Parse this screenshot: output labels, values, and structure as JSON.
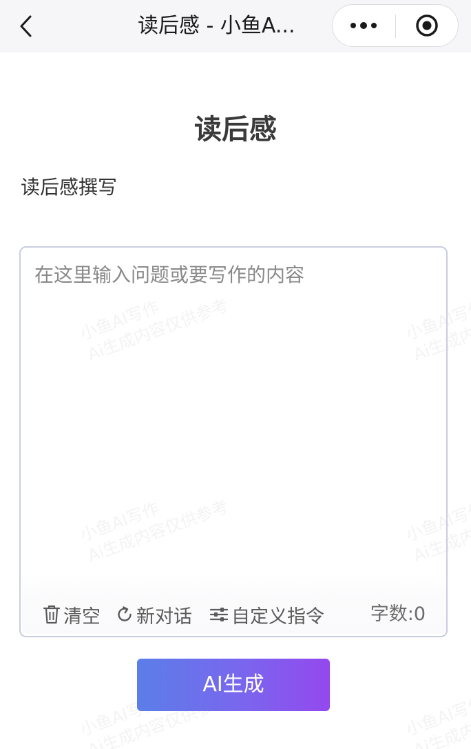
{
  "navbar": {
    "title": "读后感 - 小鱼A...",
    "back_icon": "chevron-left-icon",
    "more_icon": "more-dots-icon",
    "close_icon": "target-circle-icon"
  },
  "page": {
    "title": "读后感",
    "subtitle": "读后感撰写"
  },
  "editor": {
    "value": "",
    "placeholder": "在这里输入问题或要写作的内容"
  },
  "toolbar": {
    "clear_label": "清空",
    "clear_icon": "trash-icon",
    "new_chat_label": "新对话",
    "new_chat_icon": "refresh-icon",
    "custom_label": "自定义指令",
    "custom_icon": "sliders-icon",
    "word_count": "字数:0"
  },
  "generate_button": {
    "label": "AI生成"
  },
  "watermark": {
    "line1": "小鱼AI写作",
    "line2": "Ai生成内容仅供参考"
  },
  "colors": {
    "button_gradient_start": "#5b7ee8",
    "button_gradient_end": "#9448ee",
    "editor_border": "#c9cde0",
    "navbar_bg": "#f6f6f8"
  }
}
